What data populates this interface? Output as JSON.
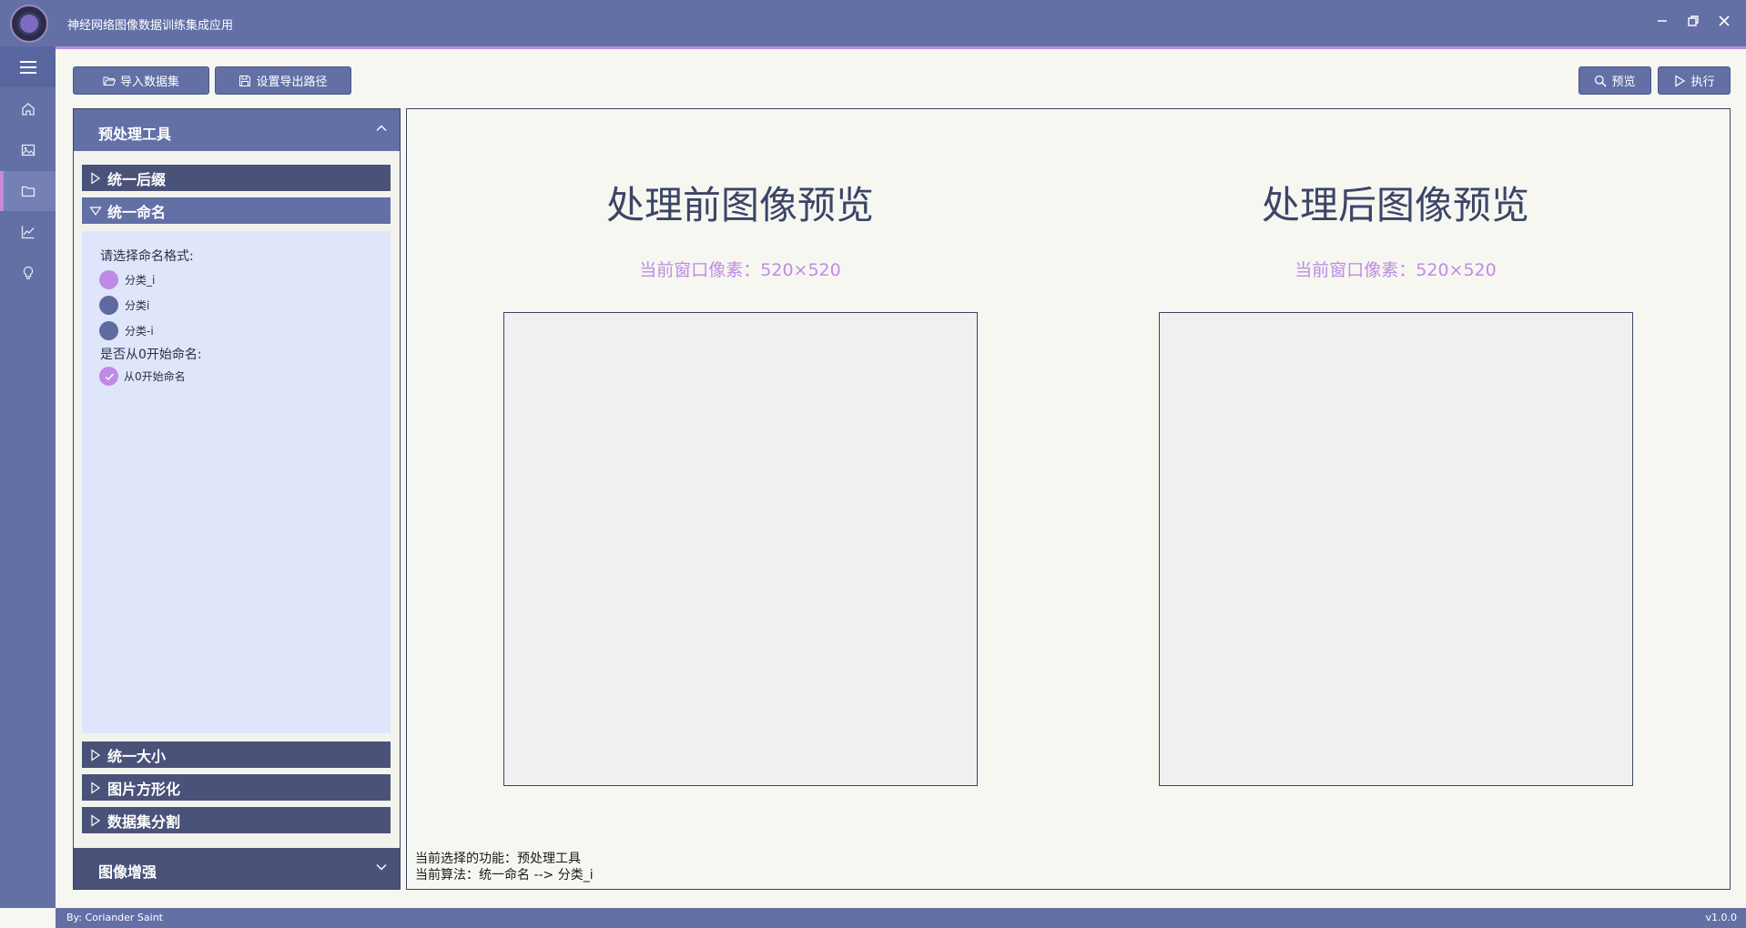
{
  "app": {
    "title": "神经网络图像数据训练集成应用",
    "colors": {
      "primary": "#6370a6",
      "dark": "#4b527a",
      "accent": "#c08be6",
      "panel_bg": "#dfe6fb"
    }
  },
  "rail": {
    "icons": [
      "menu-icon",
      "home-icon",
      "image-icon",
      "folder-icon",
      "chart-icon",
      "lightbulb-icon"
    ],
    "active": "folder-icon"
  },
  "toolbar": {
    "import_label": "导入数据集",
    "export_path_label": "设置导出路径",
    "preview_label": "预览",
    "run_label": "执行"
  },
  "left_panel": {
    "header": "预处理工具",
    "sections": {
      "suffix": "统一后缀",
      "rename": "统一命名",
      "resize": "统一大小",
      "square": "图片方形化",
      "split": "数据集分割"
    },
    "rename_body": {
      "format_label": "请选择命名格式:",
      "options": [
        "分类_i",
        "分类i",
        "分类-i"
      ],
      "selected_option": "分类_i",
      "zero_label": "是否从0开始命名:",
      "zero_checkbox": "从0开始命名",
      "zero_checked": true
    },
    "footer": "图像增强"
  },
  "preview": {
    "before_title": "处理前图像预览",
    "after_title": "处理后图像预览",
    "before_sub": "当前窗口像素：520×520",
    "after_sub": "当前窗口像素：520×520",
    "status_function": "当前选择的功能：预处理工具",
    "status_algorithm": "当前算法：统一命名 --> 分类_i"
  },
  "footer": {
    "author": "By: Coriander Saint",
    "version": "v1.0.0"
  }
}
